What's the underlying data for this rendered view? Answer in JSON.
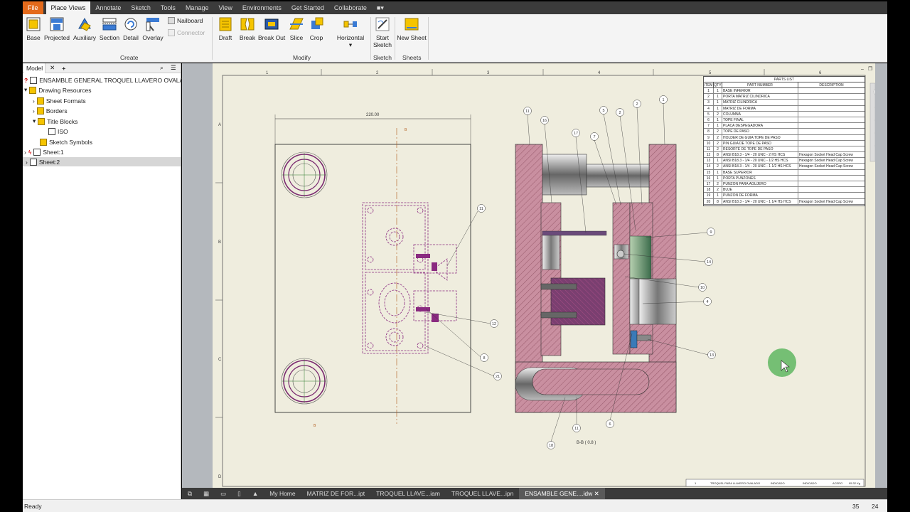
{
  "ribbon_tabs": [
    "File",
    "Place Views",
    "Annotate",
    "Sketch",
    "Tools",
    "Manage",
    "View",
    "Environments",
    "Get Started",
    "Collaborate"
  ],
  "create_group": {
    "label": "Create",
    "buttons": [
      "Base",
      "Projected",
      "Auxiliary",
      "Section",
      "Detail",
      "Overlay"
    ],
    "small": [
      "Nailboard",
      "Connector"
    ]
  },
  "modify_group": {
    "label": "Modify",
    "buttons": [
      "Draft",
      "Break",
      "Break Out",
      "Slice",
      "Crop",
      "Horizontal"
    ]
  },
  "sketch_group": {
    "label": "Sketch",
    "button_line1": "Start",
    "button_line2": "Sketch"
  },
  "sheets_group": {
    "label": "Sheets",
    "button": "New Sheet"
  },
  "browser": {
    "tab": "Model",
    "items": [
      {
        "label": "ENSAMBLE GENERAL TROQUEL LLAVERO OVALADO.idw",
        "indent": 0
      },
      {
        "label": "Drawing Resources",
        "indent": 1
      },
      {
        "label": "Sheet Formats",
        "indent": 2
      },
      {
        "label": "Borders",
        "indent": 2
      },
      {
        "label": "Title Blocks",
        "indent": 2
      },
      {
        "label": "ISO",
        "indent": 3
      },
      {
        "label": "Sketch Symbols",
        "indent": 2
      },
      {
        "label": "Sheet:1",
        "indent": 1
      },
      {
        "label": "Sheet:2",
        "indent": 1
      }
    ]
  },
  "drawing": {
    "dimension": "220.00",
    "section_label": "B-B ( 0.8 )",
    "section_marker": "B",
    "zone_numbers": [
      "1",
      "2",
      "3",
      "4",
      "5",
      "6"
    ],
    "zone_letters": [
      "A",
      "B",
      "C",
      "D"
    ],
    "balloons": [
      "11",
      "16",
      "17",
      "7",
      "5",
      "2",
      "2",
      "1",
      "11",
      "9",
      "14",
      "10",
      "4",
      "13",
      "12",
      "8",
      "21",
      "11",
      "6",
      "18"
    ],
    "title_block": [
      "1",
      "TROQUEL PARA LLAVERO OVALADO",
      "INDICADO",
      "INDICADO",
      "ACERO",
      "95.32 Kg"
    ]
  },
  "parts_list": {
    "title": "PARTS LIST",
    "headers": [
      "ITEM",
      "QTY",
      "PART NUMBER",
      "DESCRIPTION"
    ],
    "rows": [
      [
        "1",
        "1",
        "BASE INFERIOR",
        ""
      ],
      [
        "2",
        "1",
        "PORTA MATRIZ CILINDRICA",
        ""
      ],
      [
        "3",
        "1",
        "MATRIZ CILINDRICA",
        ""
      ],
      [
        "4",
        "1",
        "MATRIZ DE FORMA",
        ""
      ],
      [
        "5",
        "2",
        "COLUMNA",
        ""
      ],
      [
        "6",
        "1",
        "TOPE FINAL",
        ""
      ],
      [
        "7",
        "1",
        "PLACA DESPEGADORA",
        ""
      ],
      [
        "8",
        "2",
        "TOPE DE PASO",
        ""
      ],
      [
        "9",
        "2",
        "HOLDER DE GUIA TOPE DE PASO",
        ""
      ],
      [
        "10",
        "2",
        "PIN GUIA DE TOPE DE PASO",
        ""
      ],
      [
        "11",
        "2",
        "RESORTE DE TOPE DE PASO",
        ""
      ],
      [
        "12",
        "8",
        "ANSI B18.3 - 1/4 - 20 UNC - 2 HS HCS",
        "Hexagon Socket Head Cap Screw"
      ],
      [
        "13",
        "1",
        "ANSI B18.3 - 1/4 - 20 UNC - 1/2 HS HCS",
        "Hexagon Socket Head Cap Screw"
      ],
      [
        "14",
        "2",
        "ANSI B18.3 - 1/4 - 20 UNC - 1 1/2 HS HCS",
        "Hexagon Socket Head Cap Screw"
      ],
      [
        "15",
        "1",
        "BASE SUPERIOR",
        ""
      ],
      [
        "16",
        "1",
        "PORTA PUNZONES",
        ""
      ],
      [
        "17",
        "2",
        "PUNZON PARA AGUJERO",
        ""
      ],
      [
        "18",
        "2",
        "BUJE",
        ""
      ],
      [
        "19",
        "1",
        "PUNZON DE FORMA",
        ""
      ],
      [
        "20",
        "8",
        "ANSI B18.3 - 1/4 - 20 UNC - 1 1/4 HS HCS",
        "Hexagon Socket Head Cap Screw"
      ]
    ]
  },
  "doc_tabs": [
    "My Home",
    "MATRIZ DE FOR...ipt",
    "TROQUEL LLAVE...iam",
    "TROQUEL LLAVE...ipn",
    "ENSAMBLE GENE....idw"
  ],
  "status": {
    "text": "Ready",
    "n1": "35",
    "n2": "24"
  }
}
